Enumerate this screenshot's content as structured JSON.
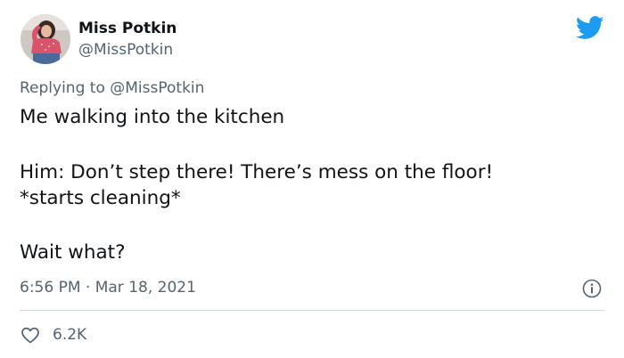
{
  "author": {
    "display_name": "Miss Potkin",
    "handle": "@MissPotkin"
  },
  "reply": {
    "prefix": "Replying to",
    "to_handle": "@MissPotkin"
  },
  "tweet": {
    "lines": [
      "Me walking into the kitchen",
      "Him: Don’t step there! There’s mess on the floor!",
      "*starts cleaning*",
      "Wait what?"
    ]
  },
  "meta": {
    "time": "6:56 PM",
    "separator": "·",
    "date": "Mar 18, 2021"
  },
  "likes": {
    "count": "6.2K"
  },
  "icons": {
    "brand": "twitter-bird-icon",
    "info": "info-icon",
    "like": "heart-icon"
  },
  "colors": {
    "brand_blue": "#1d9bf0",
    "secondary_text": "#536471",
    "primary_text": "#0f1419",
    "divider": "#cfd9de"
  }
}
